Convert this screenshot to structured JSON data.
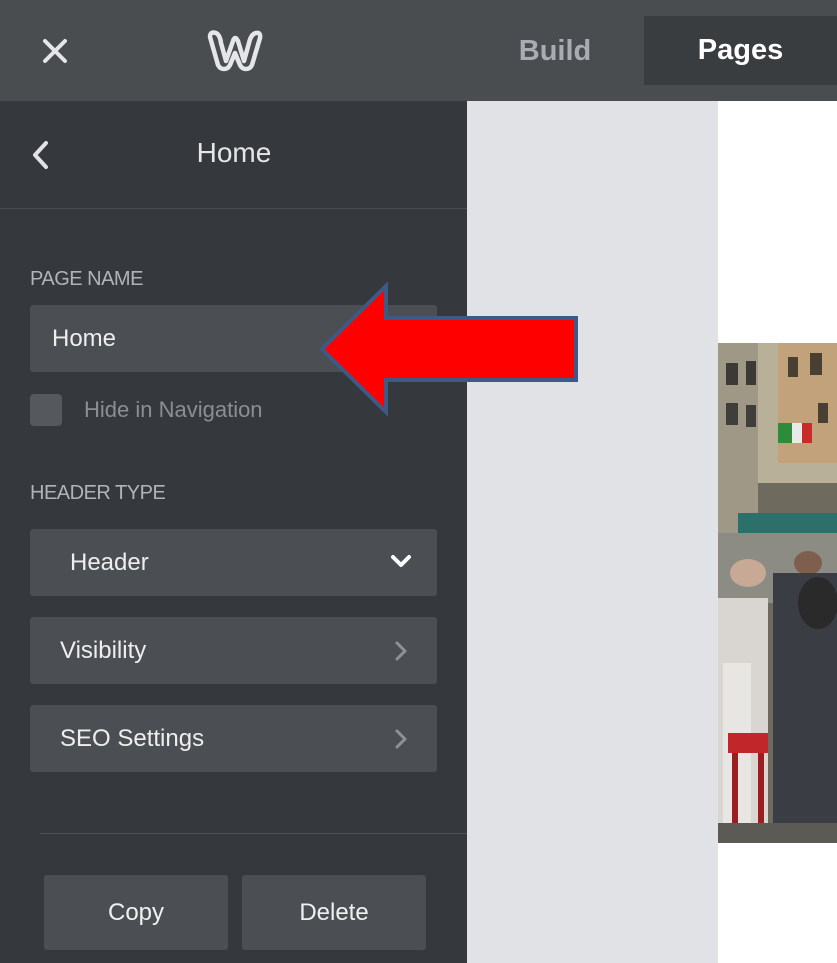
{
  "topbar": {
    "close_icon": "close-icon",
    "logo_icon": "weebly-w-logo-icon",
    "tabs": [
      {
        "label": "Build",
        "active": false
      },
      {
        "label": "Pages",
        "active": true
      }
    ],
    "colors": {
      "bar": "#4a4d50",
      "active_tab": "#3a3d40",
      "inactive_text": "#a9adb1"
    }
  },
  "sidebar": {
    "back_icon": "chevron-left-icon",
    "title": "Home",
    "page_name_label": "PAGE NAME",
    "page_name_value": "Home",
    "hide_in_nav_label": "Hide in Navigation",
    "hide_in_nav_checked": false,
    "header_type_label": "HEADER TYPE",
    "header_type_value": "Header",
    "rows": [
      {
        "label": "Visibility",
        "icon": "chevron-right-icon"
      },
      {
        "label": "SEO Settings",
        "icon": "chevron-right-icon"
      }
    ],
    "buttons": {
      "copy": "Copy",
      "delete": "Delete"
    },
    "colors": {
      "panel": "#35393d",
      "control": "#4b4f53"
    }
  },
  "annotation": {
    "arrow_icon": "red-arrow-left-icon",
    "fill": "#ff0000",
    "stroke": "#3d5a86"
  },
  "canvas": {
    "photo": "street-cafe-photo"
  }
}
